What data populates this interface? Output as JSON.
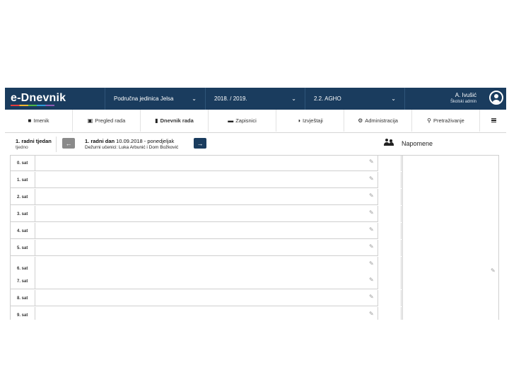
{
  "topbar": {
    "logo": "e-Dnevnik",
    "unit_select": "Područna jedinica Jelsa",
    "year_select": "2018. / 2019.",
    "class_select": "2.2. AGHO",
    "user_name": "A. Ivušić",
    "user_role": "Školski admin"
  },
  "nav": {
    "items": [
      {
        "label": "Imenik",
        "icon": "book-icon"
      },
      {
        "label": "Pregled rada",
        "icon": "clipboard-icon"
      },
      {
        "label": "Dnevnik rada",
        "icon": "journal-icon",
        "active": true
      },
      {
        "label": "Zapisnici",
        "icon": "briefcase-icon"
      },
      {
        "label": "Izvještaji",
        "icon": "pie-chart-icon"
      },
      {
        "label": "Administracija",
        "icon": "gear-icon"
      },
      {
        "label": "Pretraživanje",
        "icon": "search-icon"
      }
    ]
  },
  "header": {
    "week_title": "1. radni tjedan",
    "week_sub": "tjedno",
    "day_title_bold": "1. radni dan",
    "day_title_rest": " 10.09.2018 - ponedjeljak",
    "day_sub": "Dežurni učenici: Luka Arbunić i Dom Božković",
    "notes_title": "Napomene"
  },
  "periods": [
    "0. sat",
    "1. sat",
    "2. sat",
    "3. sat",
    "4. sat",
    "5. sat",
    "6. sat",
    "7. sat",
    "8. sat",
    "9. sat"
  ],
  "colors": {
    "primary": "#1a3c5e",
    "prev_button": "#8a8a8a"
  }
}
